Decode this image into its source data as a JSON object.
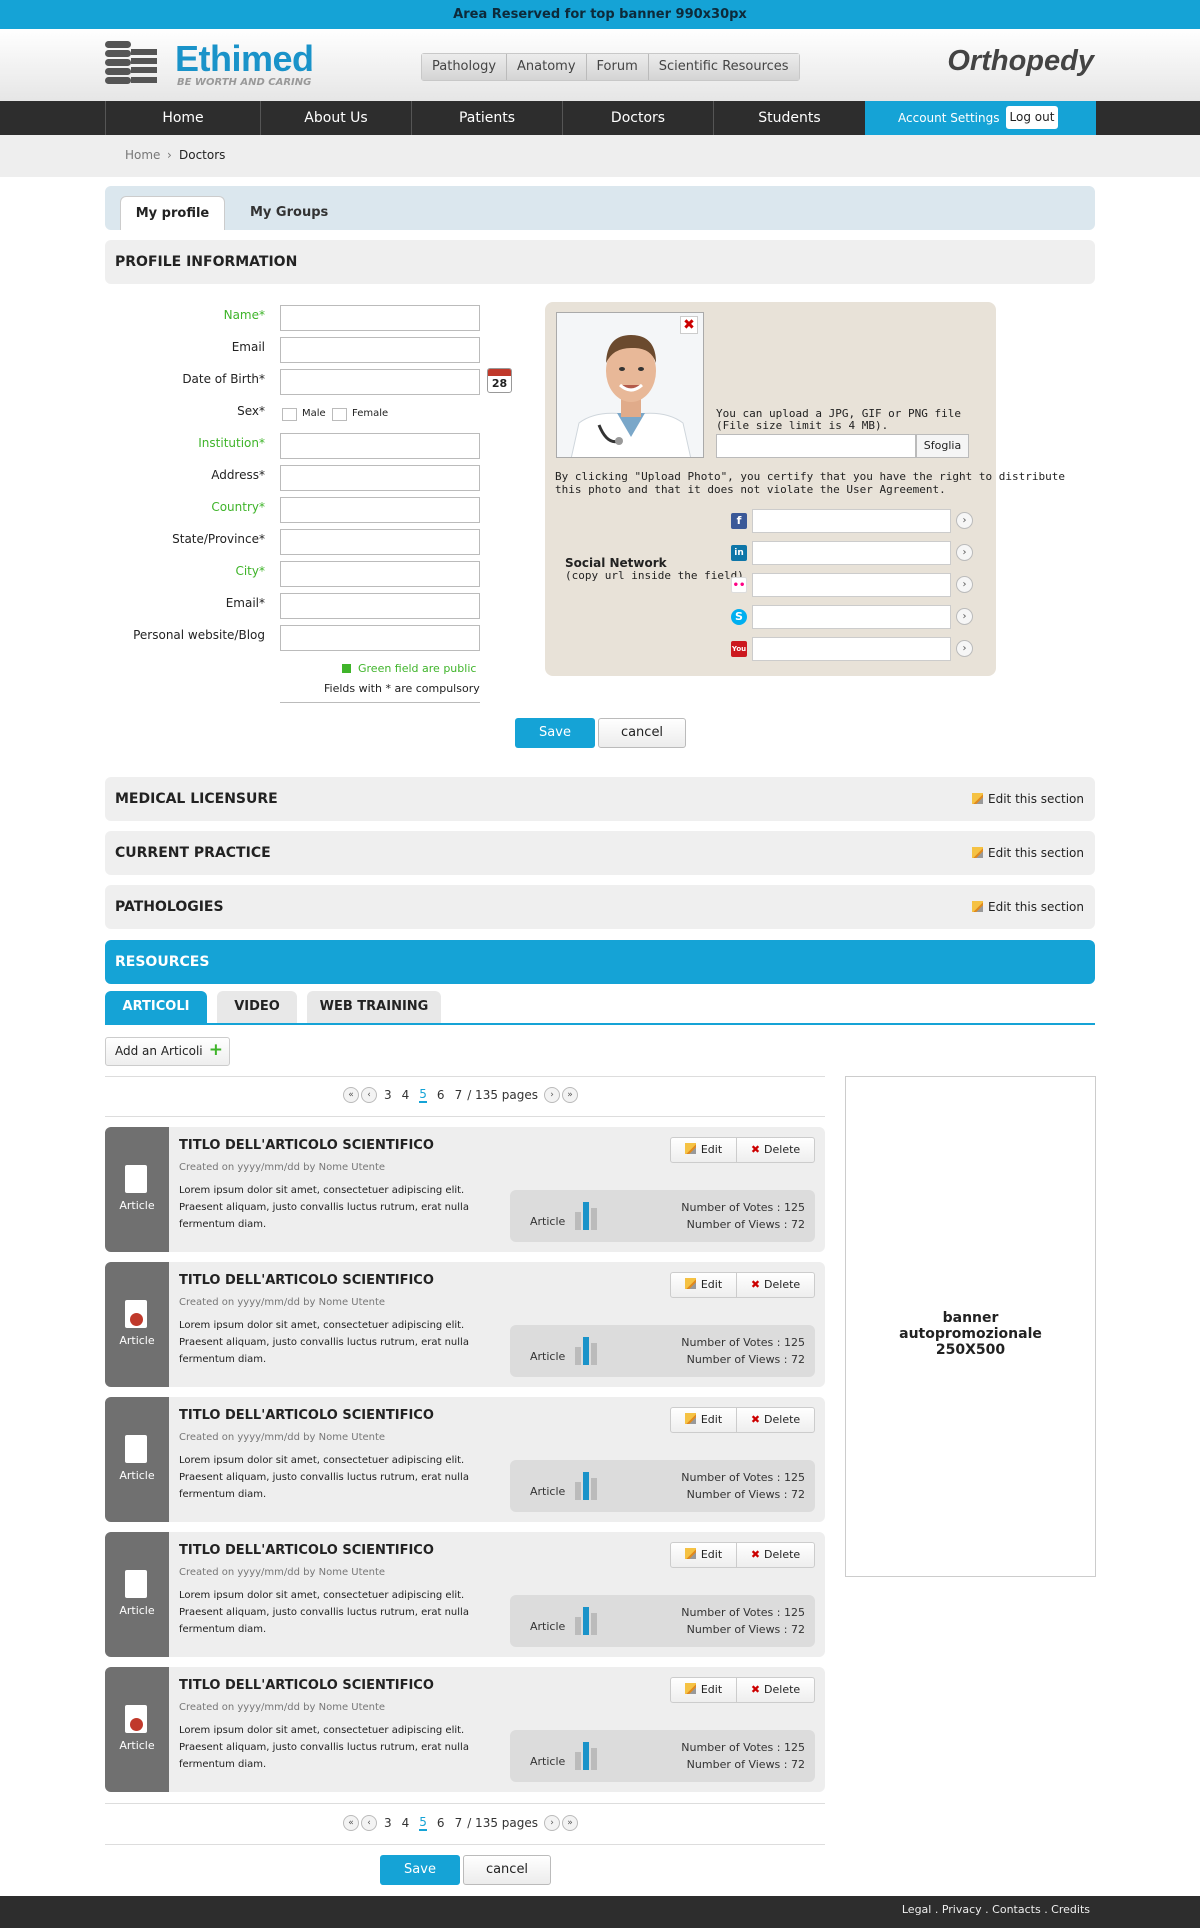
{
  "top_banner": "Area Reserved for top banner 990x30px",
  "brand": {
    "name": "Ethimed",
    "tagline": "BE WORTH AND CARING",
    "section": "Orthopedy",
    "accent": "#15a3d6"
  },
  "top_nav": [
    "Pathology",
    "Anatomy",
    "Forum",
    "Scientific Resources"
  ],
  "main_nav": [
    "Home",
    "About Us",
    "Patients",
    "Doctors",
    "Students"
  ],
  "account": {
    "settings": "Account Settings",
    "logout": "Log out"
  },
  "breadcrumb": {
    "home": "Home",
    "current": "Doctors"
  },
  "profile_tabs": [
    "My profile",
    "My Groups"
  ],
  "profile_section_title": "PROFILE INFORMATION",
  "form": {
    "fields": [
      {
        "label": "Name*",
        "public": true
      },
      {
        "label": "Email",
        "public": false
      },
      {
        "label": "Date of Birth*",
        "public": false
      },
      {
        "label": "Sex*",
        "public": false
      },
      {
        "label": "Institution*",
        "public": true
      },
      {
        "label": "Address*",
        "public": false
      },
      {
        "label": "Country*",
        "public": true
      },
      {
        "label": "State/Province*",
        "public": false
      },
      {
        "label": "City*",
        "public": true
      },
      {
        "label": "Email*",
        "public": false
      },
      {
        "label": "Personal website/Blog",
        "public": false
      }
    ],
    "sex_options": [
      "Male",
      "Female"
    ],
    "calendar_day": "28",
    "legend_public": "Green field are public",
    "legend_required": "Fields with * are compulsory",
    "save": "Save",
    "cancel": "cancel"
  },
  "photo": {
    "upload_hint_1": "You can upload a JPG, GIF or PNG file",
    "upload_hint_2": "(File size limit is 4 MB).",
    "browse": "Sfoglia",
    "disclaimer_1": "By clicking \"Upload Photo\", you certify that you have the right to distribute",
    "disclaimer_2": "this photo and that it does not violate the User Agreement.",
    "remove": "✖"
  },
  "social": {
    "title": "Social Network",
    "subtitle": "(copy url inside the field)",
    "networks": [
      {
        "icon": "facebook-icon",
        "glyph": "f",
        "color": "#3b5998"
      },
      {
        "icon": "linkedin-icon",
        "glyph": "in",
        "color": "#0e76a8"
      },
      {
        "icon": "flickr-icon",
        "glyph": "••",
        "color": "#ffffff"
      },
      {
        "icon": "skype-icon",
        "glyph": "S",
        "color": "#00aff0"
      },
      {
        "icon": "youtube-icon",
        "glyph": "You",
        "color": "#cc181e"
      }
    ]
  },
  "sections": [
    {
      "title": "MEDICAL LICENSURE",
      "edit": "Edit this section"
    },
    {
      "title": "CURRENT PRACTICE",
      "edit": "Edit this section"
    },
    {
      "title": "PATHOLOGIES",
      "edit": "Edit this section"
    }
  ],
  "resources": {
    "title": "RESOURCES",
    "tabs": [
      "ARTICOLI",
      "VIDEO",
      "WEB TRAINING"
    ],
    "add": "Add an Articoli",
    "pager": {
      "pages": [
        "3",
        "4",
        "5",
        "6",
        "7"
      ],
      "current": "5",
      "total": "/ 135 pages"
    },
    "articles": [
      {
        "type": "Article",
        "seal": false,
        "title": "TITLO DELL'ARTICOLO SCIENTIFICO",
        "meta": "Created on yyyy/mm/dd by Nome Utente",
        "body": "Lorem ipsum dolor sit amet, consectetuer adipiscing elit. Praesent aliquam, justo convallis luctus rutrum, erat nulla fermentum diam.",
        "edit": "Edit",
        "delete": "Delete",
        "votes": "Number of Votes : 125",
        "views": "Number of Views : 72"
      },
      {
        "type": "Article",
        "seal": true,
        "title": "TITLO DELL'ARTICOLO SCIENTIFICO",
        "meta": "Created on yyyy/mm/dd by Nome Utente",
        "body": "Lorem ipsum dolor sit amet, consectetuer adipiscing elit. Praesent aliquam, justo convallis luctus rutrum, erat nulla fermentum diam.",
        "edit": "Edit",
        "delete": "Delete",
        "votes": "Number of Votes : 125",
        "views": "Number of Views : 72"
      },
      {
        "type": "Article",
        "seal": false,
        "title": "TITLO DELL'ARTICOLO SCIENTIFICO",
        "meta": "Created on yyyy/mm/dd by Nome Utente",
        "body": "Lorem ipsum dolor sit amet, consectetuer adipiscing elit. Praesent aliquam, justo convallis luctus rutrum, erat nulla fermentum diam.",
        "edit": "Edit",
        "delete": "Delete",
        "votes": "Number of Votes : 125",
        "views": "Number of Views : 72"
      },
      {
        "type": "Article",
        "seal": false,
        "title": "TITLO DELL'ARTICOLO SCIENTIFICO",
        "meta": "Created on yyyy/mm/dd by Nome Utente",
        "body": "Lorem ipsum dolor sit amet, consectetuer adipiscing elit. Praesent aliquam, justo convallis luctus rutrum, erat nulla fermentum diam.",
        "edit": "Edit",
        "delete": "Delete",
        "votes": "Number of Votes : 125",
        "views": "Number of Views : 72"
      },
      {
        "type": "Article",
        "seal": true,
        "title": "TITLO DELL'ARTICOLO SCIENTIFICO",
        "meta": "Created on yyyy/mm/dd by Nome Utente",
        "body": "Lorem ipsum dolor sit amet, consectetuer adipiscing elit. Praesent aliquam, justo convallis luctus rutrum, erat nulla fermentum diam.",
        "edit": "Edit",
        "delete": "Delete",
        "votes": "Number of Votes : 125",
        "views": "Number of Views : 72"
      }
    ],
    "save": "Save",
    "cancel": "cancel"
  },
  "side_banner": [
    "banner",
    "autopromozionale",
    "250X500"
  ],
  "footer": "Legal . Privacy . Contacts . Credits"
}
